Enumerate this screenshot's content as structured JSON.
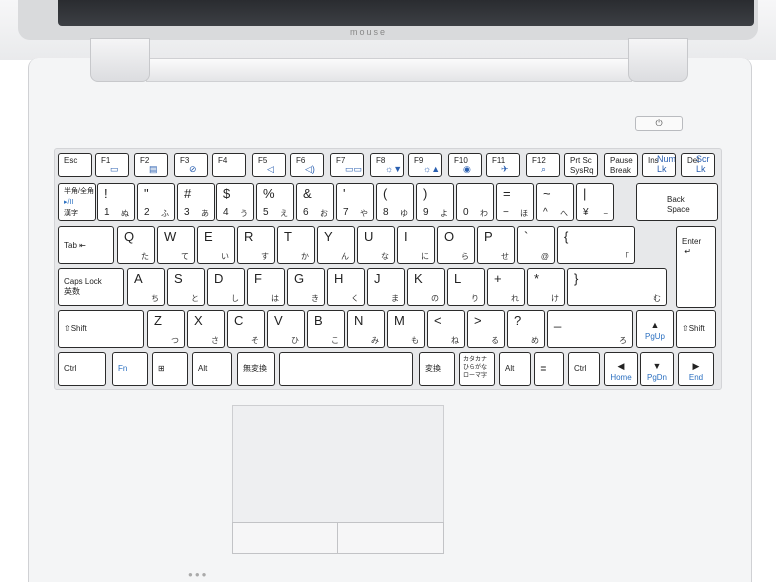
{
  "brand": "mouse",
  "power_symbol": "⏻",
  "fn_row": [
    {
      "label": "Esc",
      "icon": ""
    },
    {
      "label": "F1",
      "icon": "▭"
    },
    {
      "label": "F2",
      "icon": "▤"
    },
    {
      "label": "F3",
      "icon": "⊘"
    },
    {
      "label": "F4",
      "icon": ""
    },
    {
      "label": "F5",
      "icon": "◁"
    },
    {
      "label": "F6",
      "icon": "◁)"
    },
    {
      "label": "F7",
      "icon": "▭▭"
    },
    {
      "label": "F8",
      "icon": "☼▼"
    },
    {
      "label": "F9",
      "icon": "☼▲"
    },
    {
      "label": "F10",
      "icon": "◉"
    },
    {
      "label": "F11",
      "icon": "✈"
    },
    {
      "label": "F12",
      "icon": "⌕"
    },
    {
      "label": "Prt Sc\nSysRq",
      "icon": ""
    },
    {
      "label": "Pause\nBreak",
      "icon": ""
    },
    {
      "label": "Ins",
      "icon": "Num Lk"
    },
    {
      "label": "Del",
      "icon": "Scr Lk"
    }
  ],
  "row1": [
    {
      "top": "半角/全角",
      "bot": "漢字",
      "blue": "▸/II"
    },
    {
      "top": "!",
      "bot": "1",
      "kana": "ぬ"
    },
    {
      "top": "\"",
      "bot": "2",
      "kana": "ふ"
    },
    {
      "top": "#",
      "bot": "3",
      "kana": "あ"
    },
    {
      "top": "$",
      "bot": "4",
      "kana": "う"
    },
    {
      "top": "%",
      "bot": "5",
      "kana": "え"
    },
    {
      "top": "&",
      "bot": "6",
      "kana": "お"
    },
    {
      "top": "'",
      "bot": "7",
      "kana": "や"
    },
    {
      "top": "(",
      "bot": "8",
      "kana": "ゆ"
    },
    {
      "top": ")",
      "bot": "9",
      "kana": "よ"
    },
    {
      "top": "",
      "bot": "0",
      "kana": "わ"
    },
    {
      "top": "=",
      "bot": "−",
      "kana": "ほ"
    },
    {
      "top": "~",
      "bot": "^",
      "kana": "へ"
    },
    {
      "top": "|",
      "bot": "¥",
      "kana": "−"
    },
    {
      "top": "Back\nSpace",
      "bot": "",
      "kana": ""
    }
  ],
  "row2": [
    {
      "top": "Tab",
      "bot": "",
      "kana": ""
    },
    {
      "top": "Q",
      "kana": "た"
    },
    {
      "top": "W",
      "kana": "て"
    },
    {
      "top": "E",
      "kana": "い"
    },
    {
      "top": "R",
      "kana": "す"
    },
    {
      "top": "T",
      "kana": "か"
    },
    {
      "top": "Y",
      "kana": "ん"
    },
    {
      "top": "U",
      "kana": "な"
    },
    {
      "top": "I",
      "kana": "に"
    },
    {
      "top": "O",
      "kana": "ら"
    },
    {
      "top": "P",
      "kana": "せ"
    },
    {
      "top": "`",
      "kana": "@"
    },
    {
      "top": "{",
      "kana": "「"
    },
    {
      "top": "Enter",
      "kana": ""
    }
  ],
  "row3": [
    {
      "top": "Caps Lock\n英数",
      "kana": ""
    },
    {
      "top": "A",
      "kana": "ち"
    },
    {
      "top": "S",
      "kana": "と"
    },
    {
      "top": "D",
      "kana": "し"
    },
    {
      "top": "F",
      "kana": "は"
    },
    {
      "top": "G",
      "kana": "き"
    },
    {
      "top": "H",
      "kana": "く"
    },
    {
      "top": "J",
      "kana": "ま"
    },
    {
      "top": "K",
      "kana": "の"
    },
    {
      "top": "L",
      "kana": "り"
    },
    {
      "top": "+",
      "kana": "れ"
    },
    {
      "top": "*",
      "kana": "け"
    },
    {
      "top": "}",
      "kana": "む"
    }
  ],
  "row4": [
    {
      "top": "⇧Shift",
      "kana": ""
    },
    {
      "top": "Z",
      "kana": "つ"
    },
    {
      "top": "X",
      "kana": "さ"
    },
    {
      "top": "C",
      "kana": "そ"
    },
    {
      "top": "V",
      "kana": "ひ"
    },
    {
      "top": "B",
      "kana": "こ"
    },
    {
      "top": "N",
      "kana": "み"
    },
    {
      "top": "M",
      "kana": "も"
    },
    {
      "top": "<",
      "kana": "ね"
    },
    {
      "top": ">",
      "kana": "る"
    },
    {
      "top": "?",
      "kana": "め"
    },
    {
      "top": "_",
      "kana": "ろ"
    },
    {
      "top": "▲",
      "kana": "PgUp"
    },
    {
      "top": "⇧Shift",
      "kana": ""
    }
  ],
  "row5": [
    {
      "label": "Ctrl"
    },
    {
      "label": "Fn"
    },
    {
      "label": "⊞"
    },
    {
      "label": "Alt"
    },
    {
      "label": "無変換"
    },
    {
      "label": ""
    },
    {
      "label": "変換"
    },
    {
      "label": "カタカナ\nひらがな\nローマ字"
    },
    {
      "label": "Alt"
    },
    {
      "label": "≣"
    },
    {
      "label": "Ctrl"
    },
    {
      "label": "◀\nHome"
    },
    {
      "label": "▼\nPgDn"
    },
    {
      "label": "▶\nEnd"
    }
  ]
}
